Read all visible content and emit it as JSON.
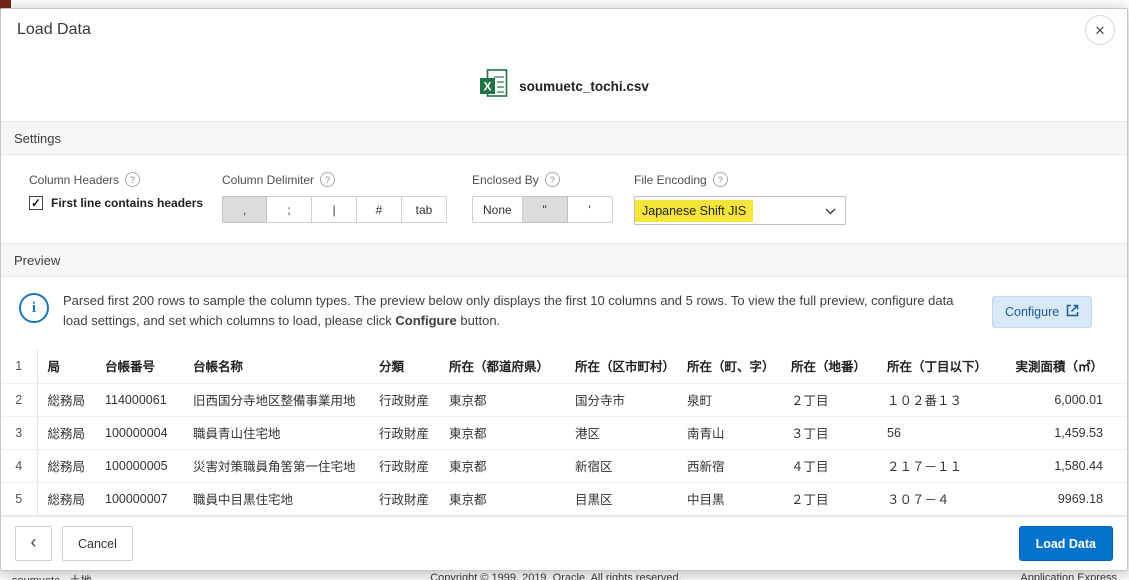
{
  "colors": {
    "primary_button": "#0572ce",
    "encoding_highlight": "#f6e539",
    "configure_button_bg": "#d9e8f7",
    "info_accent": "#1b76ba"
  },
  "icons": {
    "close_glyph": "✕",
    "back_glyph": "‹",
    "check_glyph": "✓",
    "help_glyph": "?",
    "info_glyph": "i"
  },
  "background": {
    "footer_left": "soumuetc - 土地",
    "footer_center": "Copyright © 1999, 2019, Oracle. All rights reserved.",
    "footer_right": "Application Express"
  },
  "modal": {
    "title": "Load Data",
    "file": {
      "name": "soumuetc_tochi.csv"
    },
    "settings": {
      "section_label": "Settings",
      "column_headers": {
        "label": "Column Headers",
        "checkbox_label": "First line contains headers",
        "checked": true
      },
      "column_delimiter": {
        "label": "Column Delimiter",
        "options": [
          ",",
          ";",
          "|",
          "#",
          "tab"
        ],
        "selected": ","
      },
      "enclosed_by": {
        "label": "Enclosed By",
        "options": [
          "None",
          "\"",
          "'"
        ],
        "selected": "\""
      },
      "file_encoding": {
        "label": "File Encoding",
        "value": "Japanese Shift JIS"
      }
    },
    "preview": {
      "section_label": "Preview",
      "info_text_1": "Parsed first 200 rows to sample the column types. The preview below only displays the first 10 columns and 5 rows. To view the full preview, configure data load settings, and set which columns to load, please click ",
      "info_bold": "Configure",
      "info_text_2": " button.",
      "configure_button": "Configure"
    },
    "table": {
      "header_row_num": "1",
      "columns": [
        "局",
        "台帳番号",
        "台帳名称",
        "分類",
        "所在（都道府県）",
        "所在（区市町村）",
        "所在（町、字）",
        "所在（地番）",
        "所在（丁目以下）",
        "実測面積（㎡）"
      ],
      "rows": [
        {
          "num": "2",
          "cells": [
            "総務局",
            "114000061",
            "旧西国分寺地区整備事業用地",
            "行政財産",
            "東京都",
            "国分寺市",
            "泉町",
            "２丁目",
            "１０２番１３",
            "6,000.01"
          ]
        },
        {
          "num": "3",
          "cells": [
            "総務局",
            "100000004",
            "職員青山住宅地",
            "行政財産",
            "東京都",
            "港区",
            "南青山",
            "３丁目",
            "56",
            "1,459.53"
          ]
        },
        {
          "num": "4",
          "cells": [
            "総務局",
            "100000005",
            "災害対策職員角筈第一住宅地",
            "行政財産",
            "東京都",
            "新宿区",
            "西新宿",
            "４丁目",
            "２１７－１１",
            "1,580.44"
          ]
        },
        {
          "num": "5",
          "cells": [
            "総務局",
            "100000007",
            "職員中目黒住宅地",
            "行政財産",
            "東京都",
            "目黒区",
            "中目黒",
            "２丁目",
            "３０７－４",
            "9969.18"
          ]
        }
      ]
    },
    "footer": {
      "cancel_label": "Cancel",
      "load_label": "Load Data"
    }
  }
}
